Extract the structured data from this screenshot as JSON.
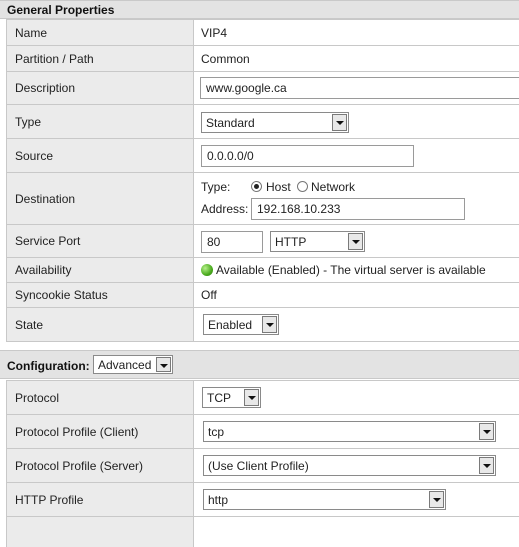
{
  "general": {
    "title": "General Properties",
    "name": {
      "label": "Name",
      "value": "VIP4"
    },
    "partition": {
      "label": "Partition / Path",
      "value": "Common"
    },
    "description": {
      "label": "Description",
      "value": "www.google.ca"
    },
    "type": {
      "label": "Type",
      "value": "Standard"
    },
    "source": {
      "label": "Source",
      "value": "0.0.0.0/0"
    },
    "destination": {
      "label": "Destination",
      "type_label": "Type:",
      "host_label": "Host",
      "network_label": "Network",
      "selected": "Host",
      "address_label": "Address:",
      "address_value": "192.168.10.233"
    },
    "service_port": {
      "label": "Service Port",
      "port_value": "80",
      "protocol_value": "HTTP"
    },
    "availability": {
      "label": "Availability",
      "status_color": "#4aaa1e",
      "value": "Available (Enabled) - The virtual server is available"
    },
    "syncookie": {
      "label": "Syncookie Status",
      "value": "Off"
    },
    "state": {
      "label": "State",
      "value": "Enabled"
    }
  },
  "configuration": {
    "title": "Configuration:",
    "mode": "Advanced",
    "protocol": {
      "label": "Protocol",
      "value": "TCP"
    },
    "profile_client": {
      "label": "Protocol Profile (Client)",
      "value": "tcp"
    },
    "profile_server": {
      "label": "Protocol Profile (Server)",
      "value": "(Use Client Profile)"
    },
    "http_profile": {
      "label": "HTTP Profile",
      "value": "http"
    }
  }
}
